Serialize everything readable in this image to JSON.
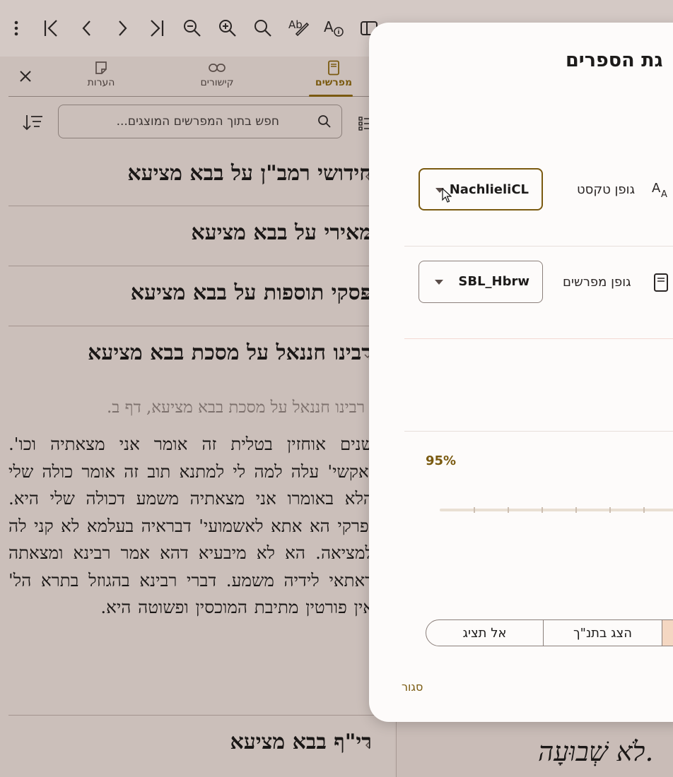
{
  "toolbar": {
    "buttons": [
      "more-vert",
      "first-page",
      "previous",
      "next",
      "last-page",
      "zoom-out",
      "zoom-in",
      "search",
      "spell-check",
      "font-info",
      "toggle-panel"
    ]
  },
  "panel": {
    "tabs": [
      {
        "label": "מפרשים",
        "icon": "book-icon",
        "active": true
      },
      {
        "label": "קישורים",
        "icon": "link-icon",
        "active": false
      },
      {
        "label": "הערות",
        "icon": "note-icon",
        "active": false
      }
    ],
    "search_placeholder": "חפש בתוך המפרשים המוצגים...",
    "commentaries": [
      {
        "title": "חידושי רמב\"ן על בבא מציעא",
        "expanded": false
      },
      {
        "title": "מאירי על בבא מציעא",
        "expanded": false
      },
      {
        "title": "פסקי תוספות על בבא מציעא",
        "expanded": false
      },
      {
        "title": "רבינו חננאל על מסכת בבא מציעא",
        "expanded": true
      },
      {
        "title": "רי\"ף בבא מציעא",
        "expanded": false
      }
    ],
    "open_commentary": {
      "subtitle": "רבינו חננאל על מסכת בבא מציעא, דף ב.",
      "text": "שנים אוחזין בטלית זה אומר אני מצאתיה וכו'. ואקשי' עלה למה לי למתנא תוב זה אומר כולה שלי הלא באומרו אני מצאתיה משמע דכולה שלי היא. ופרקי הא אתא לאשמועי' דבראיה בעלמא לא קני לה למציאה. הא לא מיבעיא דהא אמר רבינא ומצאתה דאתאי לידיה משמע. דברי רבינא בהגוזל בתרא הל' אין פורטין מתיבת המוכסין ופשוטה היא."
    }
  },
  "background_text": "לֹא שְׁבוּעָה.",
  "dialog": {
    "title": "הגדרות תצוגת הספרים",
    "title_visible": "גת הספרים",
    "text_font": {
      "label": "גופן טקסט",
      "value": "NachlieliCL"
    },
    "commentary_font": {
      "label": "גופן מפרשים",
      "value": "SBL_Hbrw"
    },
    "zoom_percent": "95%",
    "zoom_value": 0.95,
    "display_options": [
      "אל תציג",
      "הצג בתנ\"ך",
      ""
    ],
    "close_label": "סגור"
  },
  "colors": {
    "accent": "#7a5a10",
    "panel_bg": "#cbbfba",
    "dialog_bg": "#fdfbfa",
    "selected_segment": "#f4d7c2"
  }
}
